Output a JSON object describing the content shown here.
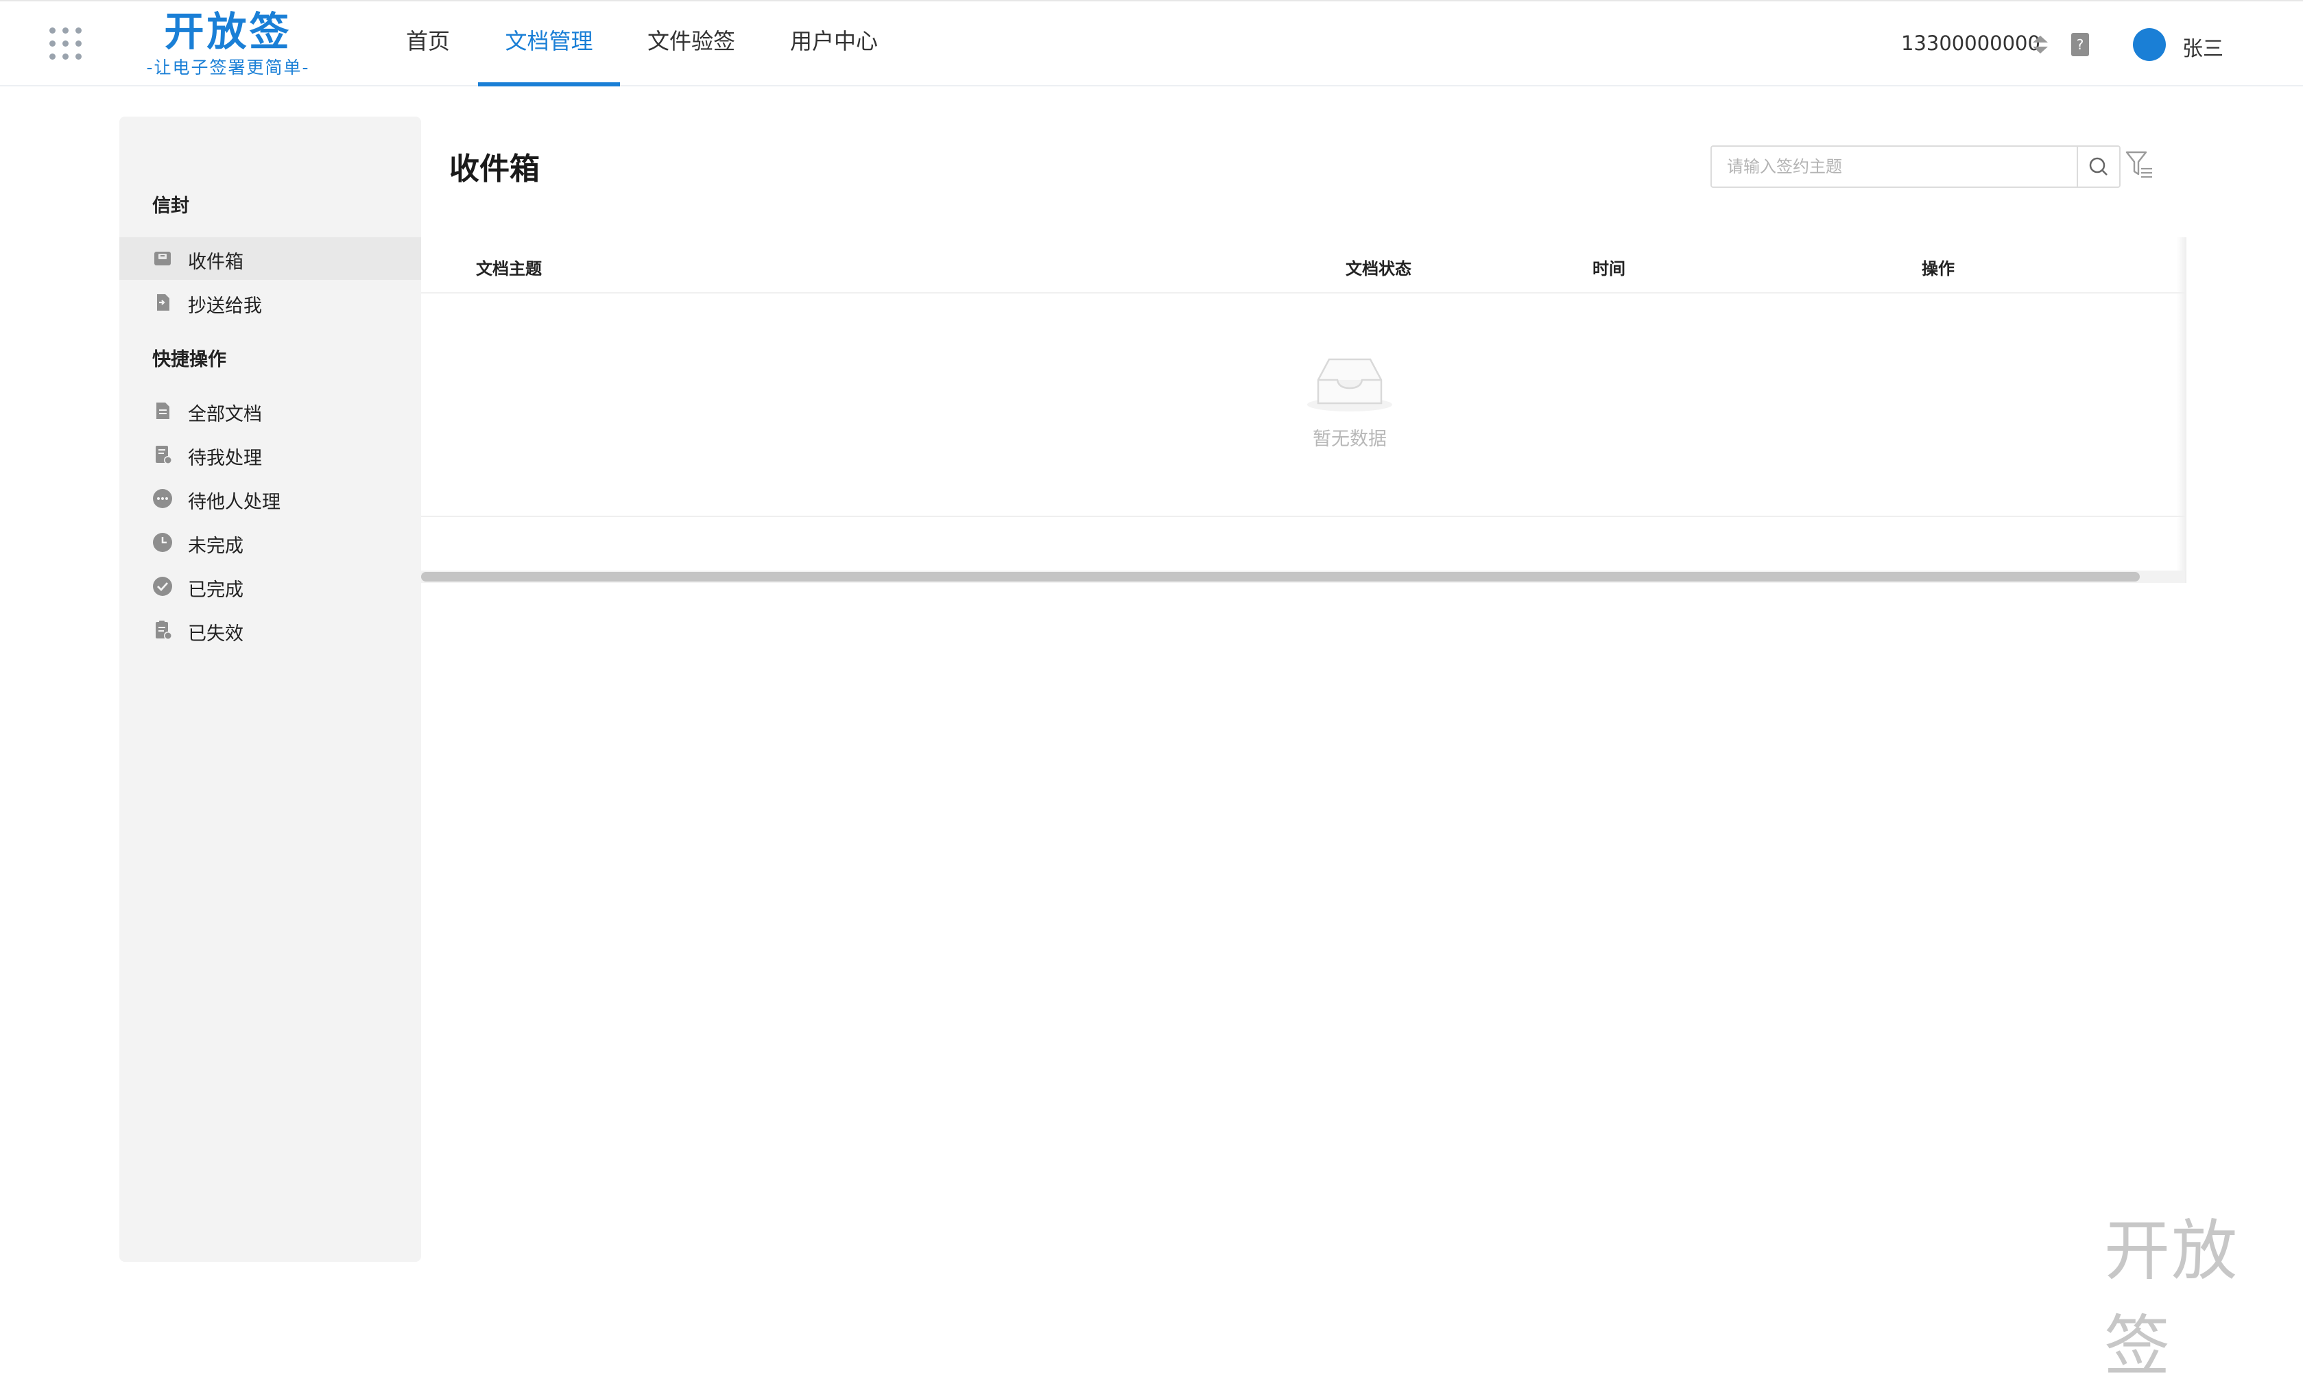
{
  "brand": {
    "title": "开放签",
    "slogan": "-让电子签署更简单-"
  },
  "nav": {
    "items": [
      {
        "label": "首页",
        "active": false
      },
      {
        "label": "文档管理",
        "active": true
      },
      {
        "label": "文件验签",
        "active": false
      },
      {
        "label": "用户中心",
        "active": false
      }
    ]
  },
  "account": {
    "phone": "13300000000",
    "username": "张三",
    "avatar_color": "#1a7fd6"
  },
  "sidebar": {
    "group_envelope": "信封",
    "envelope_items": [
      {
        "label": "收件箱",
        "icon": "inbox-icon",
        "active": true
      },
      {
        "label": "抄送给我",
        "icon": "cc-doc-icon",
        "active": false
      }
    ],
    "group_quick": "快捷操作",
    "quick_items": [
      {
        "label": "全部文档",
        "icon": "document-icon"
      },
      {
        "label": "待我处理",
        "icon": "pending-me-icon"
      },
      {
        "label": "待他人处理",
        "icon": "more-dots-icon"
      },
      {
        "label": "未完成",
        "icon": "clock-icon"
      },
      {
        "label": "已完成",
        "icon": "check-circle-icon"
      },
      {
        "label": "已失效",
        "icon": "expired-doc-icon"
      }
    ]
  },
  "main": {
    "title": "收件箱",
    "search": {
      "placeholder": "请输入签约主题",
      "value": ""
    },
    "table": {
      "columns": [
        "文档主题",
        "文档状态",
        "时间",
        "操作"
      ],
      "rows": [],
      "empty_text": "暂无数据"
    }
  },
  "watermark": "开放签",
  "colors": {
    "accent": "#1a7fd6",
    "sidebar_bg": "#f3f3f3",
    "icon_gray": "#8e8e8e"
  }
}
